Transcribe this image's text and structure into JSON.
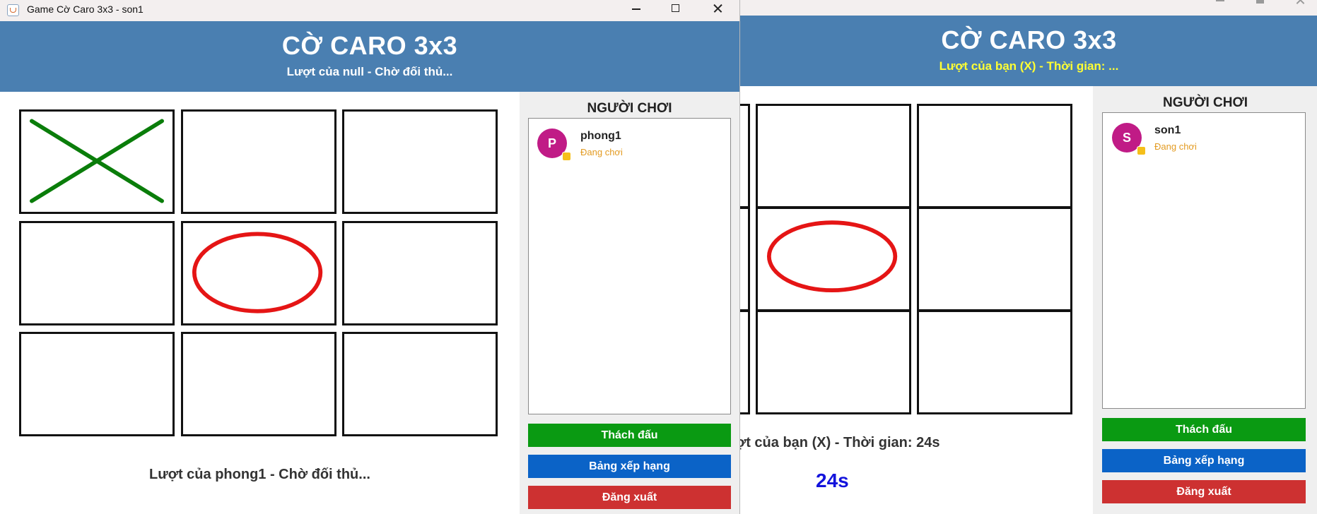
{
  "window1": {
    "title": "Game Cờ Caro 3x3 - son1",
    "header": {
      "title": "CỜ CARO 3x3",
      "subtitle": "Lượt của null - Chờ đối thủ..."
    },
    "board": [
      "X",
      "",
      "",
      "",
      "O",
      "",
      "",
      "",
      ""
    ],
    "status": "Lượt của phong1 - Chờ đối thủ...",
    "panel": {
      "title": "NGƯỜI CHƠI",
      "player": {
        "initial": "P",
        "name": "phong1",
        "status": "Đang chơi"
      },
      "buttons": {
        "challenge": "Thách đấu",
        "ranking": "Bảng xếp hạng",
        "logout": "Đăng xuất"
      }
    }
  },
  "window2": {
    "header": {
      "title": "CỜ CARO 3x3",
      "subtitle": "Lượt của bạn (X) - Thời gian: ..."
    },
    "board_visible": [
      "",
      "",
      "",
      "O",
      "",
      ""
    ],
    "status": "ợt của bạn (X) - Thời gian: 24s",
    "timer": "24s",
    "panel": {
      "title": "NGƯỜI CHƠI",
      "player": {
        "initial": "S",
        "name": "son1",
        "status": "Đang chơi"
      },
      "buttons": {
        "challenge": "Thách đấu",
        "ranking": "Bảng xếp hạng",
        "logout": "Đăng xuất"
      }
    }
  },
  "colors": {
    "header_bg": "#4a7fb1",
    "subtitle_active": "#ffff33",
    "x_mark": "#0a7d0a",
    "o_mark": "#e51515",
    "avatar": "#c01b86",
    "status_text": "#e39b22",
    "timer": "#1313dc",
    "btn_green": "#0a9a12",
    "btn_blue": "#0b63c7",
    "btn_red": "#cd3131"
  }
}
